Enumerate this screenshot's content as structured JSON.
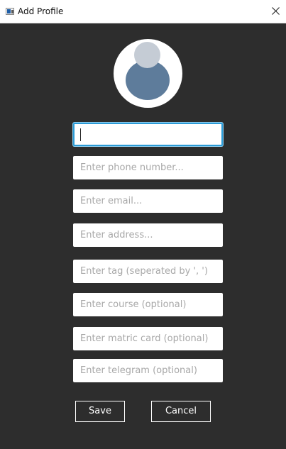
{
  "window": {
    "title": "Add Profile",
    "app_icon": "window-app-icon",
    "close_icon": "close-icon"
  },
  "avatar": {
    "icon": "user-avatar-icon",
    "colors": {
      "background": "#ffffff",
      "head": "#c5ccd5",
      "body": "#5e7c9b"
    }
  },
  "form": {
    "name": {
      "value": "",
      "placeholder": ""
    },
    "phone": {
      "value": "",
      "placeholder": "Enter phone number..."
    },
    "email": {
      "value": "",
      "placeholder": "Enter email..."
    },
    "address": {
      "value": "",
      "placeholder": "Enter address..."
    },
    "tags": {
      "value": "",
      "placeholder": "Enter tag (seperated by ', ')"
    },
    "course": {
      "value": "",
      "placeholder": "Enter course (optional)"
    },
    "matric": {
      "value": "",
      "placeholder": "Enter matric card (optional)"
    },
    "telegram": {
      "value": "",
      "placeholder": "Enter telegram (optional)"
    }
  },
  "buttons": {
    "save": "Save",
    "cancel": "Cancel"
  },
  "colors": {
    "background": "#2d2d2d",
    "focus_ring": "#2b9bd6",
    "placeholder": "#a8a8a8",
    "button_border": "#ffffff"
  }
}
